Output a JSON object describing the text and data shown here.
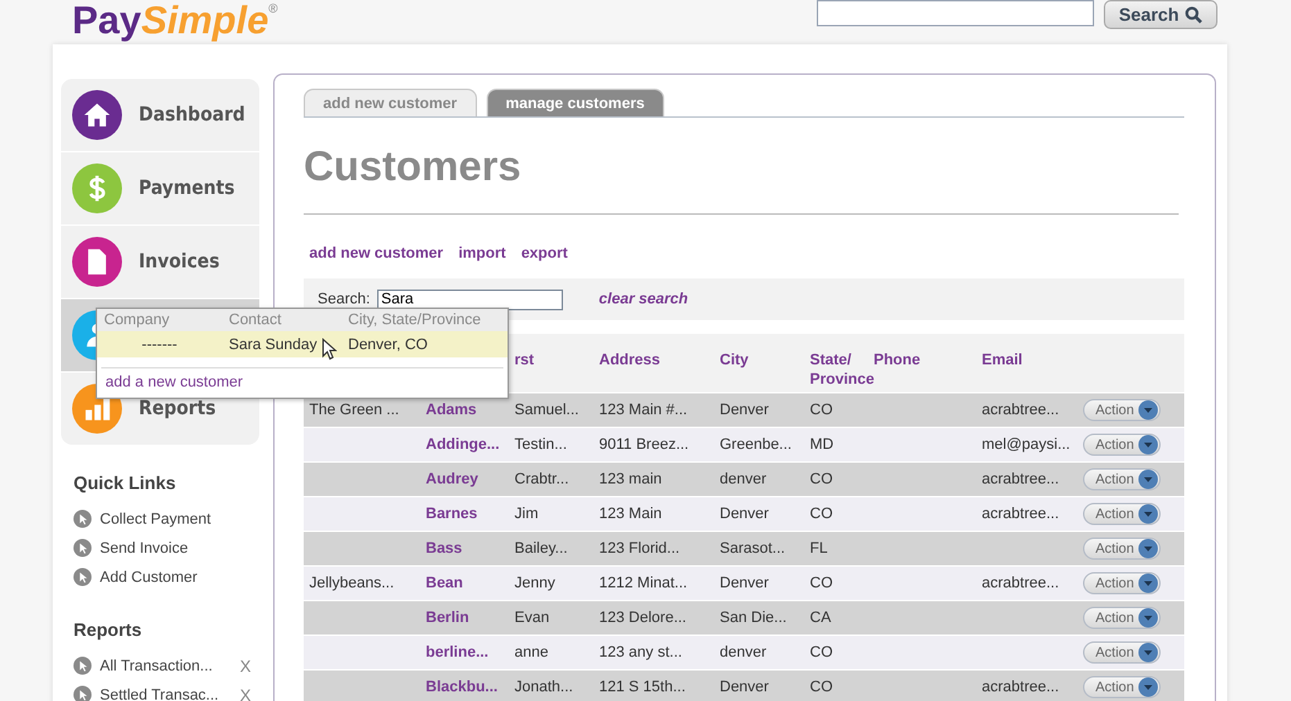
{
  "logo": {
    "part1": "Pay",
    "part2": "Simple",
    "mark": "®"
  },
  "top_search": {
    "button": "Search"
  },
  "sidebar": {
    "items": [
      {
        "kind": "home",
        "label": "Dashboard",
        "color": "#6a2c91",
        "selected": false
      },
      {
        "kind": "dollar",
        "label": "Payments",
        "color": "#8dc63f",
        "selected": false
      },
      {
        "kind": "document",
        "label": "Invoices",
        "color": "#c8248f",
        "selected": false
      },
      {
        "kind": "people",
        "color": "#1ab0e8",
        "selected": true
      },
      {
        "kind": "chart",
        "label": "Reports",
        "color": "#f7941d",
        "selected": false
      }
    ],
    "quick_links": {
      "title": "Quick Links",
      "items": [
        "Collect Payment",
        "Send Invoice",
        "Add Customer"
      ]
    },
    "reports": {
      "title": "Reports",
      "items": [
        {
          "label": "All Transaction...",
          "remove": "X"
        },
        {
          "label": "Settled Transac...",
          "remove": "X"
        }
      ]
    }
  },
  "tabs": [
    {
      "label": "add new customer",
      "selected": false
    },
    {
      "label": "manage customers",
      "selected": true
    }
  ],
  "heading": "Customers",
  "actions": [
    "add new customer",
    "import",
    "export"
  ],
  "search": {
    "label": "Search:",
    "value": "Sara",
    "clear": "clear search"
  },
  "autocomplete": {
    "columns": [
      "Company",
      "Contact",
      "City, State/Province"
    ],
    "rows": [
      {
        "company": "-------",
        "contact": "Sara Sunday",
        "city": "Denver, CO",
        "selected": true
      }
    ],
    "add": "add a new customer"
  },
  "table": {
    "columns": [
      "rst",
      "Address",
      "City",
      "State/ Province",
      "Phone",
      "Email"
    ],
    "rows": [
      {
        "company": "The Green ...",
        "last": "Adams",
        "first": "Samuel...",
        "address": "123 Main #...",
        "city": "Denver",
        "state": "CO",
        "email": "acrabtree...",
        "action": "Action"
      },
      {
        "last": "Addinge...",
        "first": "Testin...",
        "address": "9011 Breez...",
        "city": "Greenbe...",
        "state": "MD",
        "email": "mel@paysi...",
        "action": "Action"
      },
      {
        "last": "Audrey",
        "first": "Crabtr...",
        "address": "123 main",
        "city": "denver",
        "state": "CO",
        "email": "acrabtree...",
        "action": "Action"
      },
      {
        "last": "Barnes",
        "first": "Jim",
        "address": "123 Main",
        "city": "Denver",
        "state": "CO",
        "email": "acrabtree...",
        "action": "Action"
      },
      {
        "last": "Bass",
        "first": "Bailey...",
        "address": "123 Florid...",
        "city": "Sarasot...",
        "state": "FL",
        "action": "Action"
      },
      {
        "company": "Jellybeans...",
        "last": "Bean",
        "first": "Jenny",
        "address": "1212 Minat...",
        "city": "Denver",
        "state": "CO",
        "email": "acrabtree...",
        "action": "Action"
      },
      {
        "last": "Berlin",
        "first": "Evan",
        "address": "123 Delore...",
        "city": "San Die...",
        "state": "CA",
        "action": "Action"
      },
      {
        "last": "berline...",
        "first": "anne",
        "address": "123 any st...",
        "city": "denver",
        "state": "CO",
        "action": "Action"
      },
      {
        "last": "Blackbu...",
        "first": "Jonath...",
        "address": "121 S 15th...",
        "city": "Denver",
        "state": "CO",
        "email": "acrabtree...",
        "action": "Action"
      }
    ]
  }
}
